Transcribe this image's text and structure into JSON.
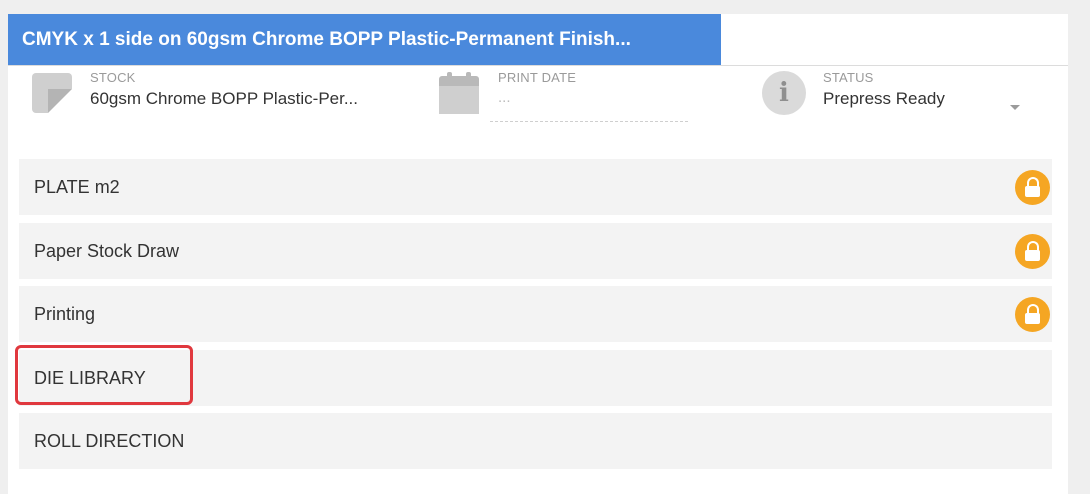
{
  "tab": {
    "title": "CMYK x 1 side on 60gsm Chrome BOPP Plastic-Permanent Finish..."
  },
  "info": {
    "stock": {
      "label": "STOCK",
      "value": "60gsm Chrome BOPP Plastic-Per...",
      "icon": "stock-icon"
    },
    "print_date": {
      "label": "PRINT DATE",
      "value": "...",
      "icon": "calendar-icon"
    },
    "status": {
      "label": "STATUS",
      "value": "Prepress Ready",
      "icon": "info-icon"
    }
  },
  "rows": [
    {
      "label": "PLATE m2",
      "locked": true
    },
    {
      "label": "Paper Stock Draw",
      "locked": true
    },
    {
      "label": "Printing",
      "locked": true
    },
    {
      "label": "DIE LIBRARY",
      "locked": false,
      "highlighted": true
    },
    {
      "label": "ROLL DIRECTION",
      "locked": false
    }
  ],
  "colors": {
    "tab": "#4a89dc",
    "lock": "#f5a623",
    "highlight": "#e0383e"
  }
}
